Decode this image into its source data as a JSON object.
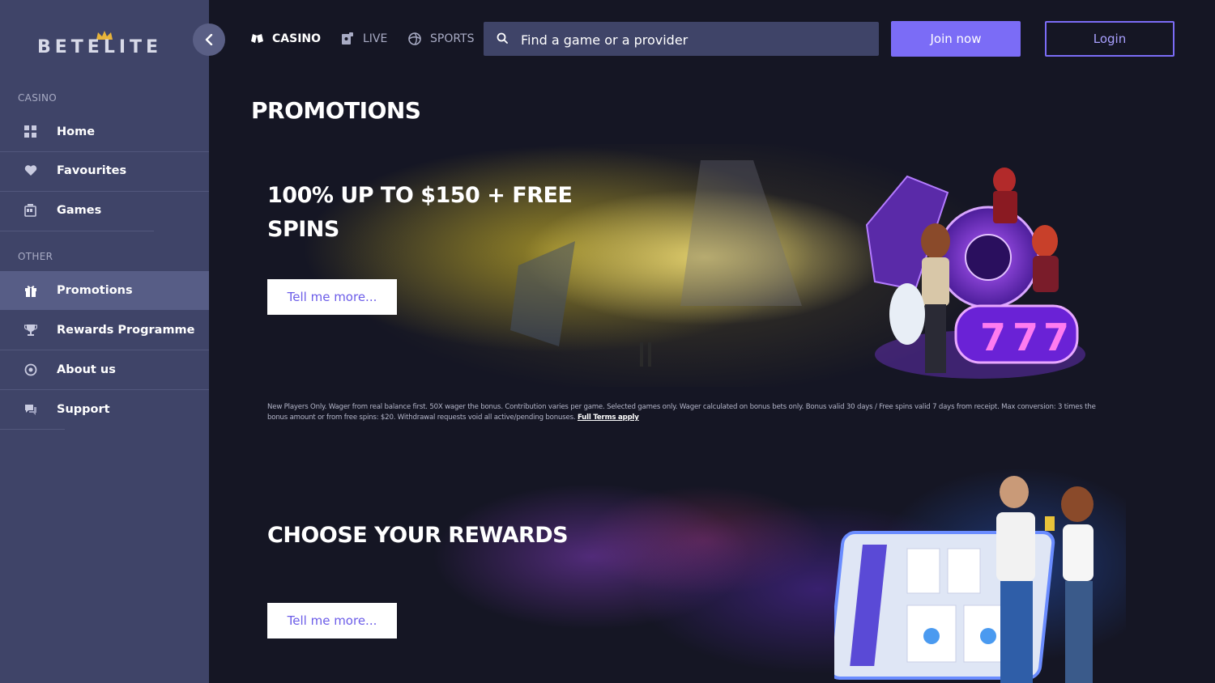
{
  "brand": {
    "logo_text": "BETELITE"
  },
  "sidebar": {
    "sections": [
      {
        "label": "CASINO"
      },
      {
        "label": "OTHER"
      }
    ],
    "items": [
      {
        "label": "Home",
        "icon": "grid-icon"
      },
      {
        "label": "Favourites",
        "icon": "heart-icon"
      },
      {
        "label": "Games",
        "icon": "slot-machine-icon"
      },
      {
        "label": "Promotions",
        "icon": "gift-icon"
      },
      {
        "label": "Rewards Programme",
        "icon": "trophy-icon"
      },
      {
        "label": "About us",
        "icon": "info-circle-icon"
      },
      {
        "label": "Support",
        "icon": "chat-icon"
      }
    ],
    "active_item": "Promotions"
  },
  "topnav": {
    "tabs": [
      {
        "label": "CASINO",
        "icon": "cards-icon",
        "active": true
      },
      {
        "label": "LIVE",
        "icon": "live-dealer-icon",
        "active": false
      },
      {
        "label": "SPORTS",
        "icon": "ball-icon",
        "active": false
      }
    ],
    "search": {
      "placeholder": "Find a game or a provider",
      "value": ""
    },
    "join_label": "Join now",
    "login_label": "Login"
  },
  "main": {
    "title": "PROMOTIONS",
    "promos": [
      {
        "heading_line1": "100% UP TO $150 + FREE",
        "heading_line2": "SPINS",
        "button_label": "Tell me more...",
        "terms": "New Players Only. Wager from real balance first. 50X wager the bonus. Contribution varies per game. Selected games only. Wager calculated on bonus bets only. Bonus valid 30 days / Free spins valid 7 days from receipt. Max conversion: 3 times the bonus amount or from free spins: $20. Withdrawal requests void all active/pending bonuses.",
        "terms_link": "Full Terms apply"
      },
      {
        "heading_line1": "CHOOSE YOUR REWARDS",
        "button_label": "Tell me more..."
      }
    ]
  },
  "colors": {
    "page_bg": "#151624",
    "sidebar_bg": "#3f4468",
    "sidebar_active": "#575d86",
    "accent": "#7b6cf6"
  }
}
